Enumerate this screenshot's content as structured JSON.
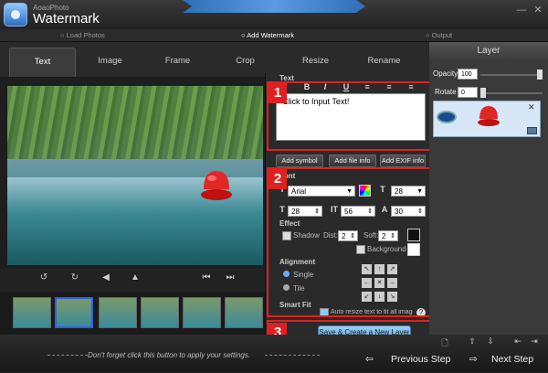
{
  "app": {
    "brand_small": "AoaoPhoto",
    "brand_big": "Watermark"
  },
  "window_buttons": {
    "minimize": "—",
    "close": "✕"
  },
  "steps": [
    "Load Photos",
    "Add Watermark",
    "Output"
  ],
  "tabs": [
    "Text",
    "Image",
    "Frame",
    "Crop",
    "Resize",
    "Rename"
  ],
  "active_tab": "Text",
  "text_group": {
    "title": "Text",
    "format_buttons": [
      "B",
      "I",
      "U",
      "≡",
      "≡",
      "≡"
    ],
    "input_value": "Click to Input Text!",
    "buttons": [
      "Add symbol",
      "Add file info",
      "Add EXIF info"
    ]
  },
  "font_group": {
    "title": "Font",
    "font_name": "Arial",
    "font_size": "28",
    "width": "28",
    "height": "56",
    "spacing": "30"
  },
  "effect_group": {
    "title": "Effect",
    "shadow_label": "Shadow",
    "dist_label": "Dist:",
    "dist_value": "2",
    "soft_label": "Soft:",
    "soft_value": "2",
    "background_label": "Background"
  },
  "alignment_group": {
    "title": "Alignment",
    "single_label": "Single",
    "tile_label": "Tile",
    "grid": [
      "↖",
      "↑",
      "↗",
      "←",
      "✕",
      "→",
      "↙",
      "↓",
      "↘"
    ]
  },
  "smart_fit": {
    "title": "Smart Fit",
    "auto_resize_label": "Auto resize text to fit all images",
    "help": "?"
  },
  "save_button": "Save & Create a New Layer",
  "callouts": [
    "1",
    "2",
    "3"
  ],
  "layer_panel": {
    "title": "Layer",
    "opacity_label": "Opacity",
    "opacity_value": "100",
    "rotate_label": "Rotate",
    "rotate_value": "0",
    "close": "✕"
  },
  "hint": "Don't forget click this button to apply your settings.",
  "nav": {
    "previous": "Previous Step",
    "next": "Next Step"
  },
  "colors": {
    "accent": "#2e6fb8",
    "callout": "#e02020",
    "layer_item": "#d7e7f8"
  }
}
